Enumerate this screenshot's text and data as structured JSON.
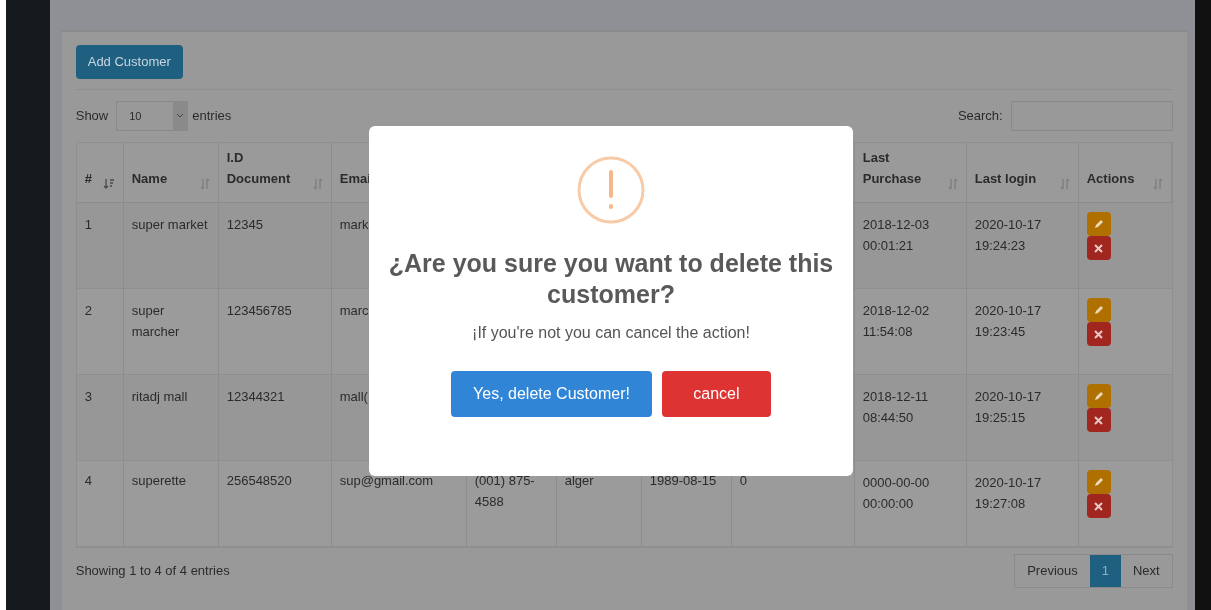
{
  "toolbar": {
    "add_button": "Add Customer"
  },
  "length_control": {
    "label_before": "Show",
    "value": "10",
    "label_after": "entries"
  },
  "search": {
    "label": "Search:"
  },
  "table": {
    "columns": [
      {
        "label": "#",
        "sorted": true
      },
      {
        "label": "Name",
        "sorted": false
      },
      {
        "label": "I.D Document",
        "sorted": false
      },
      {
        "label": "Emai"
      }
    ],
    "right_columns": [
      {
        "label": "Last Purchase",
        "sorted": false
      },
      {
        "label": "Last login",
        "sorted": false
      },
      {
        "label": "Actions",
        "sorted": false
      }
    ],
    "rows": [
      {
        "number": "1",
        "name": "super market",
        "id_document": "12345",
        "email": "mark",
        "last_purchase": "2018-12-03 00:01:21",
        "last_login": "2020-10-17 19:24:23"
      },
      {
        "number": "2",
        "name": "super marcher",
        "id_document": "123456785",
        "email": "marc",
        "last_purchase": "2018-12-02 11:54:08",
        "last_login": "2020-10-17 19:23:45"
      },
      {
        "number": "3",
        "name": "ritadj mall",
        "id_document": "12344321",
        "email": "mall(",
        "last_purchase": "2018-12-11 08:44:50",
        "last_login": "2020-10-17 19:25:15"
      },
      {
        "number": "4",
        "name": "superette",
        "id_document": "256548520",
        "email": "sup@gmail.com",
        "phone": "(001) 875-4588",
        "city": "alger",
        "birth": "1989-08-15",
        "purchases": "0",
        "last_purchase": "0000-00-00 00:00:00",
        "last_login": "2020-10-17 19:27:08"
      }
    ]
  },
  "footer": {
    "info": "Showing 1 to 4 of 4 entries",
    "pages": [
      {
        "label": "Previous",
        "selected": false
      },
      {
        "label": "1",
        "selected": true
      },
      {
        "label": "Next",
        "selected": false
      }
    ]
  },
  "dialog": {
    "title": "¿Are you sure you want to delete this customer?",
    "text": "¡If you're not you can cancel the action!",
    "confirm": "Yes, delete Customer!",
    "cancel": "cancel"
  }
}
